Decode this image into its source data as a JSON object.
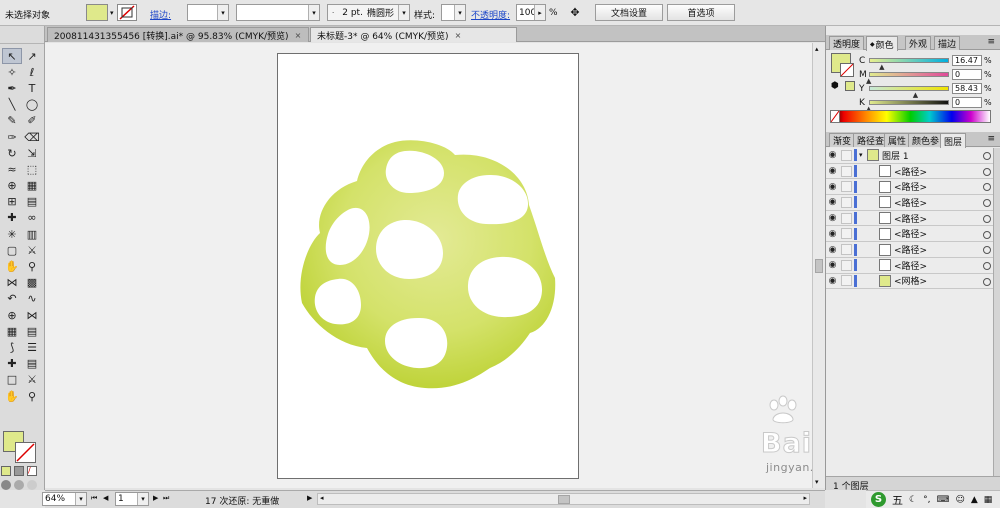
{
  "control_bar": {
    "selection_status": "未选择对象",
    "stroke_label": "描边:",
    "stroke_weight": "2 pt.",
    "brush_shape": "椭圆形",
    "style_label": "样式:",
    "opacity_label": "不透明度:",
    "opacity_value": "100",
    "opacity_unit": "%",
    "doc_setup_button": "文档设置",
    "prefs_button": "首选项"
  },
  "doc_tabs": [
    {
      "label": "200811431355456 [转换].ai* @ 95.83% (CMYK/预览)",
      "close": "×"
    },
    {
      "label": "未标题-3* @ 64% (CMYK/预览)",
      "close": "×"
    }
  ],
  "colors": {
    "fill": "#dfe98b",
    "artwork_gradient_center": "#e3ea95",
    "artwork_gradient_edge": "#bdd235",
    "accent": "#4a6fd4"
  },
  "tools": [
    "selection-icon",
    "direct-selection-icon",
    "magic-wand-icon",
    "lasso-icon",
    "pen-icon",
    "type-icon",
    "line-segment-icon",
    "ellipse-icon",
    "paintbrush-icon",
    "pencil-icon",
    "blob-brush-icon",
    "eraser-icon",
    "rotate-icon",
    "scale-icon",
    "warp-icon",
    "free-transform-icon",
    "shape-builder-icon",
    "perspective-grid-icon",
    "mesh-icon",
    "gradient-icon",
    "eyedropper-icon",
    "blend-icon",
    "symbol-sprayer-icon",
    "column-graph-icon",
    "artboard-icon",
    "slice-icon",
    "hand-icon",
    "zoom-icon",
    "width-icon",
    "live-paint-icon",
    "curve-icon",
    "wave-icon",
    "crosshair-icon",
    "envelope-icon",
    "grid-icon",
    "chart-icon",
    "zigzag-icon",
    "list-icon",
    "eyedropper-2-icon",
    "gradient-2-icon",
    "rect-icon",
    "knife-icon",
    "hand-2-icon",
    "zoom-2-icon"
  ],
  "tool_glyphs": [
    "↖",
    "↗",
    "✧",
    "ℓ",
    "✒",
    "T",
    "╲",
    "◯",
    "✎",
    "✐",
    "✑",
    "⌫",
    "↻",
    "⇲",
    "≈",
    "⬚",
    "⊕",
    "▦",
    "⊞",
    "▤",
    "✚",
    "∞",
    "✳",
    "▥",
    "▢",
    "⚔",
    "✋",
    "⚲",
    "⋈",
    "▩",
    "↶",
    "∿",
    "⊕",
    "⋈",
    "▦",
    "▤",
    "⟆",
    "☰",
    "✚",
    "▤",
    "□",
    "⚔",
    "✋",
    "⚲"
  ],
  "color_panel": {
    "tabs": [
      "透明度",
      "颜色",
      "外观",
      "描边"
    ],
    "channels": [
      {
        "label": "C",
        "value": "16.47",
        "unit": "%"
      },
      {
        "label": "M",
        "value": "0",
        "unit": "%"
      },
      {
        "label": "Y",
        "value": "58.43",
        "unit": "%"
      },
      {
        "label": "K",
        "value": "0",
        "unit": "%"
      }
    ]
  },
  "layers_panel": {
    "tabs": [
      "渐变",
      "路径查",
      "属性",
      "颜色参",
      "图层"
    ],
    "rows": [
      {
        "name": "图层 1",
        "type": "layer"
      },
      {
        "name": "<路径>",
        "type": "path"
      },
      {
        "name": "<路径>",
        "type": "path"
      },
      {
        "name": "<路径>",
        "type": "path"
      },
      {
        "name": "<路径>",
        "type": "path"
      },
      {
        "name": "<路径>",
        "type": "path"
      },
      {
        "name": "<路径>",
        "type": "path"
      },
      {
        "name": "<路径>",
        "type": "path"
      },
      {
        "name": "<网格>",
        "type": "mesh"
      }
    ],
    "footer": "1 个图层"
  },
  "status_bar": {
    "zoom": "64%",
    "page": "1",
    "status_text": "17 次还原: 无重做"
  },
  "watermark": {
    "text": "Bai du 经验",
    "url": "jingyan.baidu.com"
  },
  "taskbar": {
    "ime_char": "五"
  }
}
